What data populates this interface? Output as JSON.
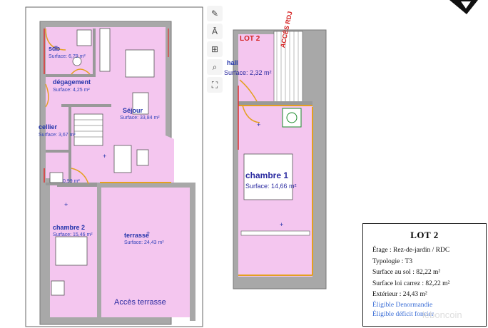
{
  "plan_left": {
    "rooms": [
      {
        "name": "sdb",
        "surface": "Surface: 6,79 m²"
      },
      {
        "name": "dégagement",
        "surface": "Surface: 4,25 m²"
      },
      {
        "name": "Séjour",
        "surface": "Surface: 33,84 m²"
      },
      {
        "name": "cellier",
        "surface": "Surface: 3,67 m²"
      },
      {
        "name": "wc",
        "surface": "0,99 m²"
      },
      {
        "name": "chambre 2",
        "surface": "Surface: 15,46 m²"
      },
      {
        "name": "terrasse",
        "surface": "Surface: 24,43 m²"
      }
    ],
    "access_label": "Accès terrasse"
  },
  "plan_right": {
    "lot_label": "LOT 2",
    "hall": {
      "name": "hall",
      "surface": "Surface: 2,32 m²"
    },
    "access_label": "ACCÈS RDJ",
    "bedroom": {
      "name": "chambre 1",
      "surface": "Surface: 14,66 m²"
    }
  },
  "toolbar": {
    "icons": [
      "image-edit-icon",
      "text-recognize-icon",
      "image-add-icon",
      "zoom-icon",
      "crop-icon"
    ]
  },
  "info_card": {
    "title": "LOT 2",
    "lines": [
      "Étage : Rez-de-jardin / RDC",
      "Typologie : T3",
      "Surface au sol : 82,22 m²",
      "Surface loi carrez : 82,22 m²",
      "Extérieur : 24,43 m²"
    ],
    "links": [
      "Éligible Denormandie",
      "Éligible déficit foncier"
    ]
  },
  "watermark": "leboncoin",
  "colors": {
    "room_fill": "#f4c6ef",
    "wall": "#909090",
    "door": "#e4a020",
    "wall_red": "#e03030",
    "text": "#2233aa",
    "link": "#3b6ed6"
  }
}
